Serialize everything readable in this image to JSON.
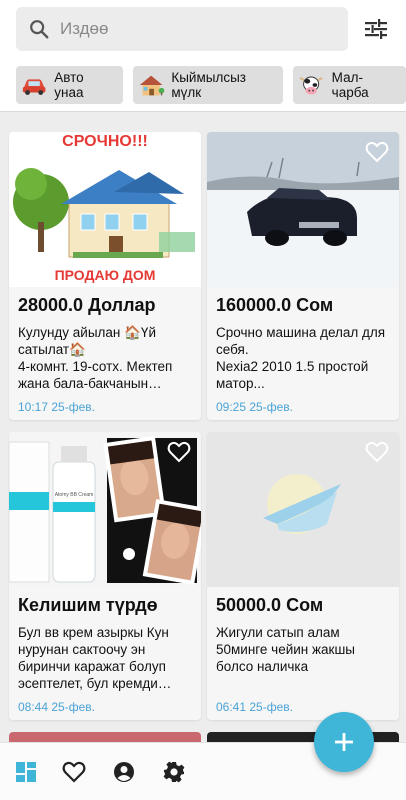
{
  "search": {
    "placeholder": "Издөө"
  },
  "categories": [
    {
      "label": "Авто унаа",
      "icon": "car-icon"
    },
    {
      "label": "Кыймылсыз мүлк",
      "icon": "house-icon"
    },
    {
      "label": "Мал-чарба",
      "icon": "cow-icon"
    }
  ],
  "listings": [
    {
      "price": "28000.0 Доллар",
      "description": "Кулунду айылан 🏠Үй сатылат🏠\n4-комнт. 19-сотх. Мектеп жана бала-бакчанын жанында",
      "date": "10:17 25-фев.",
      "banner_top": "СРОЧНО!!!",
      "banner_bottom": "ПРОДАЮ ДОМ"
    },
    {
      "price": "160000.0 Сом",
      "description": "Срочно машина делал для себя.\nNexia2 2010 1.5 простой матор...",
      "date": "09:25 25-фев."
    },
    {
      "price": "Келишим түрдө",
      "description": "Бул вв крем азыркы Кун нурунан сактоочу эн биринчи каражат болуп эсептелет, бул кремди колдонуу",
      "date": "08:44 25-фев.",
      "product_label": "Atomy BB Cream"
    },
    {
      "price": "50000.0 Сом",
      "description": "Жигули сатып алам 50минге чейин жакшы болсо наличка",
      "date": "06:41 25-фев."
    }
  ],
  "colors": {
    "accent": "#3fb5d8",
    "date": "#4aa3d6",
    "nav_active": "#3fb5d8"
  },
  "nav": [
    "grid-icon",
    "heart-icon",
    "profile-icon",
    "settings-icon"
  ]
}
